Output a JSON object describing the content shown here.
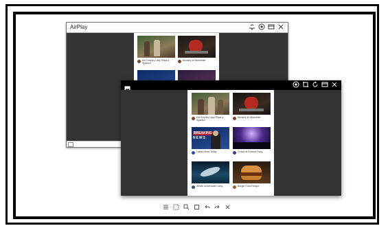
{
  "back_window": {
    "title": "AirPlay",
    "icons": [
      "cast-icon",
      "record-icon",
      "window-icon",
      "close-icon"
    ],
    "videos": [
      {
        "caption": "Kid Country Lady Plays a Spanish"
      },
      {
        "caption": "Monkey on Motorbike"
      },
      {
        "caption": "BREAKING NEWS"
      },
      {
        "caption": ""
      }
    ]
  },
  "front_window": {
    "icons": [
      "record-icon",
      "crop-icon",
      "rotate-icon",
      "window-icon",
      "close-icon"
    ],
    "badge_breaking": "BREAKING",
    "badge_news": "NEWS",
    "videos": [
      {
        "caption": "Kid Country Lady Plays a Spanish"
      },
      {
        "caption": "Monkey on Motorbike"
      },
      {
        "caption": "Latest News Today"
      },
      {
        "caption": "Crowd at Concert Party"
      },
      {
        "caption": "Whale Underwater Jump"
      },
      {
        "caption": "Burger Food Recipe"
      }
    ]
  },
  "bottom_toolbar": {
    "icons": [
      "menu-icon",
      "screenshot-icon",
      "paint-icon",
      "fullscreen-icon",
      "undo-icon",
      "redo-icon",
      "close-icon"
    ]
  }
}
